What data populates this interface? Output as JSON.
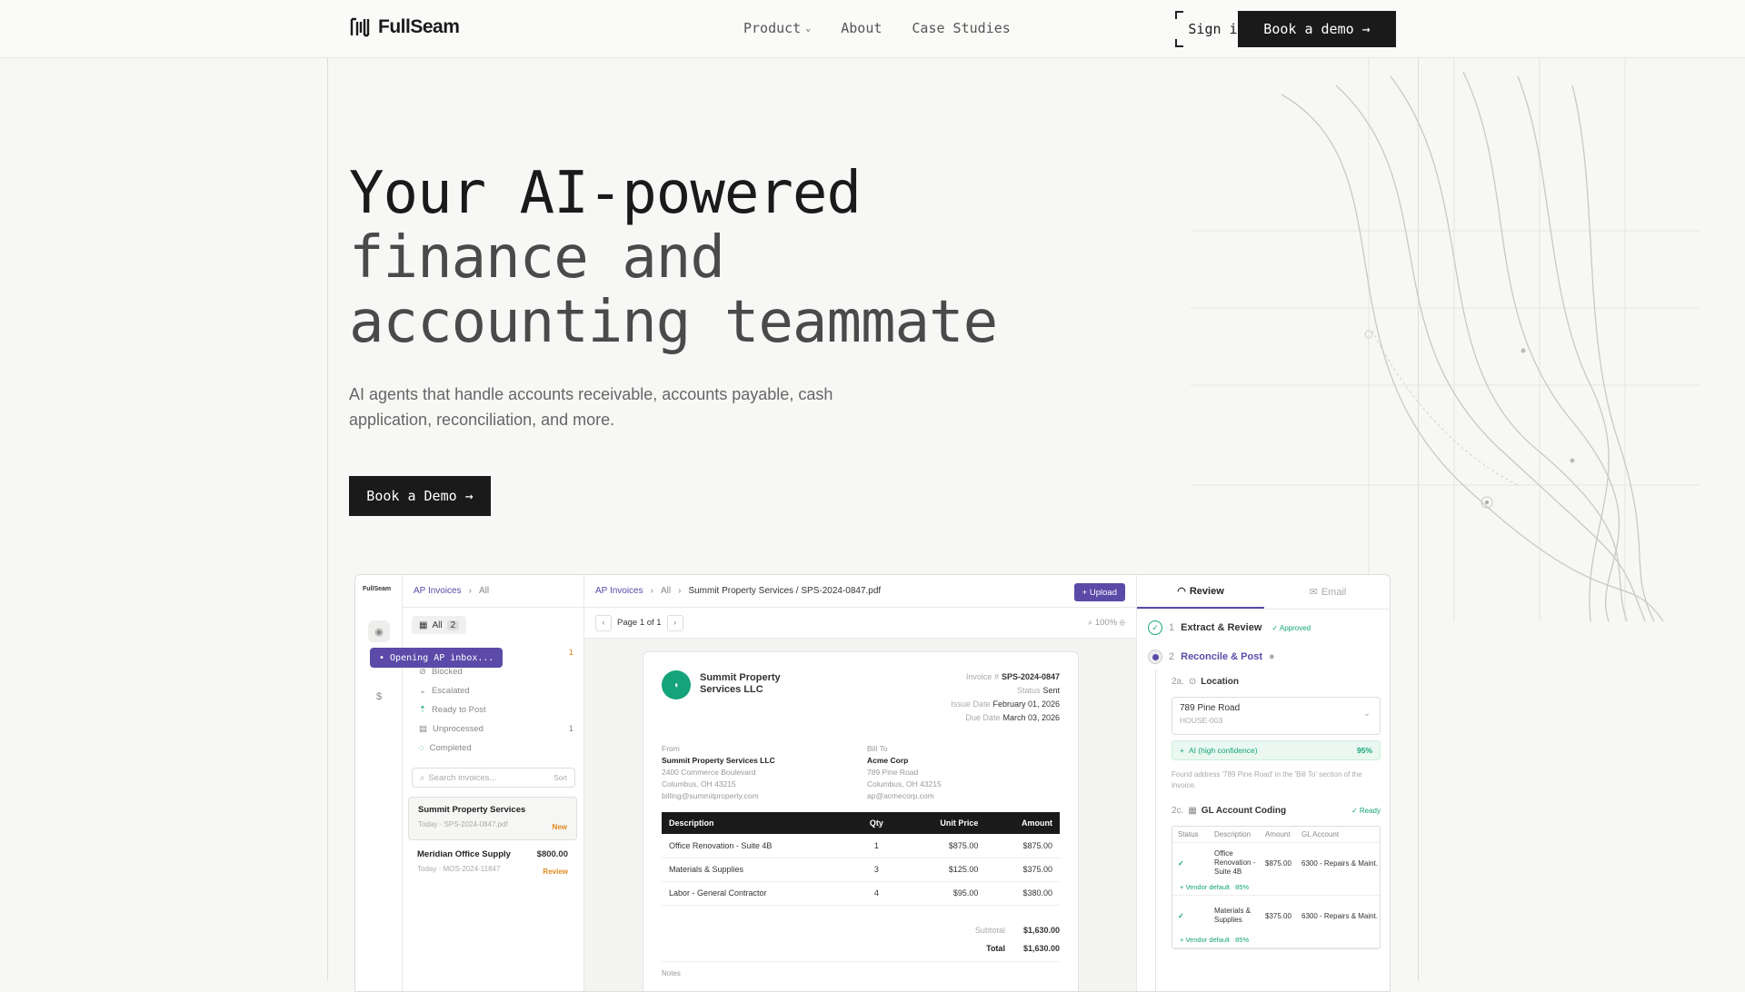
{
  "nav": {
    "brand": "FullSeam",
    "links": [
      "Product",
      "About",
      "Case Studies"
    ],
    "sign_in": "Sign in",
    "book_demo": "Book a demo →"
  },
  "hero": {
    "title_line1": "Your AI-powered",
    "title_line2": "finance and",
    "title_line3": "accounting teammate",
    "subtitle": "AI agents that handle accounts receivable, accounts payable, cash application, reconciliation, and more.",
    "cta": "Book a Demo →"
  },
  "app": {
    "rail_brand": "FullSeam",
    "list": {
      "crumb1": "AP Invoices",
      "crumb2": "All",
      "all_label": "All",
      "all_count": "2",
      "toast": "Opening AP inbox...",
      "filters": [
        {
          "label": "Blocked",
          "count": ""
        },
        {
          "label": "Escalated",
          "count": ""
        },
        {
          "label": "Ready to Post",
          "count": ""
        },
        {
          "label": "Unprocessed",
          "count": "1"
        },
        {
          "label": "Completed",
          "count": ""
        }
      ],
      "first_count": "1",
      "search_placeholder": "Search invoices...",
      "sort": "Sort",
      "cards": [
        {
          "title": "Summit Property Services",
          "sub": "Today · SPS-2024-0847.pdf",
          "amount": "",
          "tag": "New"
        },
        {
          "title": "Meridian Office Supply",
          "sub": "Today · MOS-2024-11847",
          "amount": "$800.00",
          "tag": "Review"
        }
      ]
    },
    "doc": {
      "crumb1": "AP Invoices",
      "crumb2": "All",
      "crumb3": "Summit Property Services / SPS-2024-0847.pdf",
      "upload": "+ Upload",
      "page": "Page 1 of 1",
      "zoom": "100%",
      "vendor": "Summit Property Services LLC",
      "vendor_short": "Summit Property Services LLC",
      "meta": [
        {
          "k": "Invoice #",
          "v": "SPS-2024-0847"
        },
        {
          "k": "Status",
          "v": "Sent"
        },
        {
          "k": "Issue Date",
          "v": "February 01, 2026"
        },
        {
          "k": "Due Date",
          "v": "March 03, 2026"
        }
      ],
      "from_label": "From",
      "from_name": "Summit Property Services LLC",
      "from_lines": [
        "2400 Commerce Boulevard",
        "Columbus, OH 43215",
        "billing@summitproperty.com"
      ],
      "to_label": "Bill To",
      "to_name": "Acme Corp",
      "to_lines": [
        "789 Pine Road",
        "Columbus, OH 43215",
        "ap@acmecorp.com"
      ],
      "cols": [
        "Description",
        "Qty",
        "Unit Price",
        "Amount"
      ],
      "rows": [
        [
          "Office Renovation - Suite 4B",
          "1",
          "$875.00",
          "$875.00"
        ],
        [
          "Materials & Supplies",
          "3",
          "$125.00",
          "$375.00"
        ],
        [
          "Labor - General Contractor",
          "4",
          "$95.00",
          "$380.00"
        ]
      ],
      "subtotal_label": "Subtotal",
      "subtotal": "$1,630.00",
      "total_label": "Total",
      "total": "$1,630.00",
      "notes": "Notes"
    },
    "review": {
      "tab_review": "Review",
      "tab_email": "Email",
      "step1": "Extract & Review",
      "step1_badge": "✓ Approved",
      "step2": "Reconcile & Post",
      "loc_num": "2a.",
      "loc_label": "Location",
      "loc_value": "789 Pine Road",
      "loc_code": "HOUSE-003",
      "ai_label": "AI (high confidence)",
      "ai_pct": "95%",
      "found_note": "Found address '789 Pine Road' in the 'Bill To' section of the invoice.",
      "gl_num": "2c.",
      "gl_label": "GL Account Coding",
      "gl_ready": "✓ Ready",
      "gl_cols": [
        "Status",
        "Description",
        "Amount",
        "GL Account"
      ],
      "gl_rows": [
        {
          "desc": "Office Renovation - Suite 4B",
          "amt": "$875.00",
          "acct": "6300 - Repairs & Maint.",
          "src": "Vendor default",
          "pct": "85%"
        },
        {
          "desc": "Materials & Supplies",
          "amt": "$375.00",
          "acct": "6300 - Repairs & Maint.",
          "src": "Vendor default",
          "pct": "85%"
        }
      ]
    }
  }
}
